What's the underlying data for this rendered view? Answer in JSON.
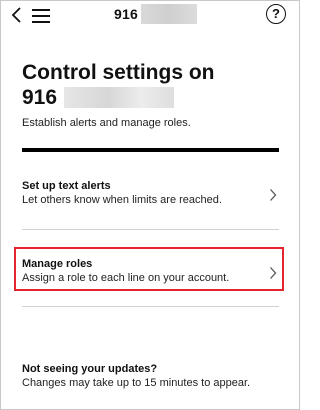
{
  "header": {
    "number_visible": "916",
    "back_icon": "chevron-left-icon",
    "menu_icon": "hamburger-menu-icon",
    "help_icon": "help-question-icon",
    "help_glyph": "?"
  },
  "main": {
    "title_line1": "Control settings on",
    "title_line2": "916",
    "subtitle": "Establish alerts and manage roles.",
    "items": [
      {
        "title": "Set up text alerts",
        "description": "Let others know when limits are reached.",
        "icon": "chevron-right-icon"
      },
      {
        "title": "Manage roles",
        "description": "Assign a role to each line on your account.",
        "icon": "chevron-right-icon",
        "highlighted": true
      }
    ]
  },
  "footer": {
    "title": "Not seeing your updates?",
    "description": "Changes may take up to 15 minutes to appear."
  },
  "colors": {
    "highlight_border": "#e4252b",
    "text": "#111111",
    "divider": "#d0d0d0"
  }
}
